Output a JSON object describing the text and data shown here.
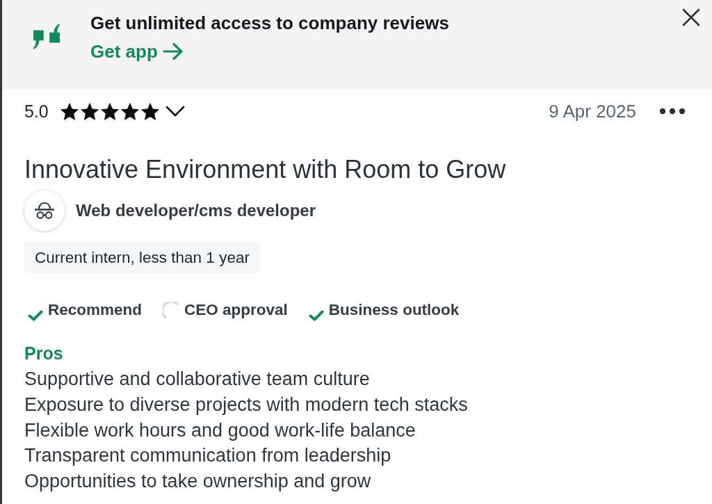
{
  "banner": {
    "headline": "Get unlimited access to company reviews",
    "link": "Get app"
  },
  "review": {
    "rating": "5.0",
    "stars": 5,
    "date": "9 Apr 2025",
    "title": "Innovative Environment with Room to Grow",
    "role": "Web developer/cms developer",
    "employment": "Current intern, less than 1 year",
    "ratings": [
      {
        "label": "Recommend",
        "kind": "positive"
      },
      {
        "label": "CEO approval",
        "kind": "neutral"
      },
      {
        "label": "Business outlook",
        "kind": "positive"
      }
    ],
    "pros": {
      "heading": "Pros",
      "items": [
        "Supportive and collaborative team culture",
        "Exposure to diverse projects with modern tech stacks",
        "Flexible work hours and good work-life balance",
        "Transparent communication from leadership",
        "Opportunities to take ownership and grow"
      ]
    }
  }
}
